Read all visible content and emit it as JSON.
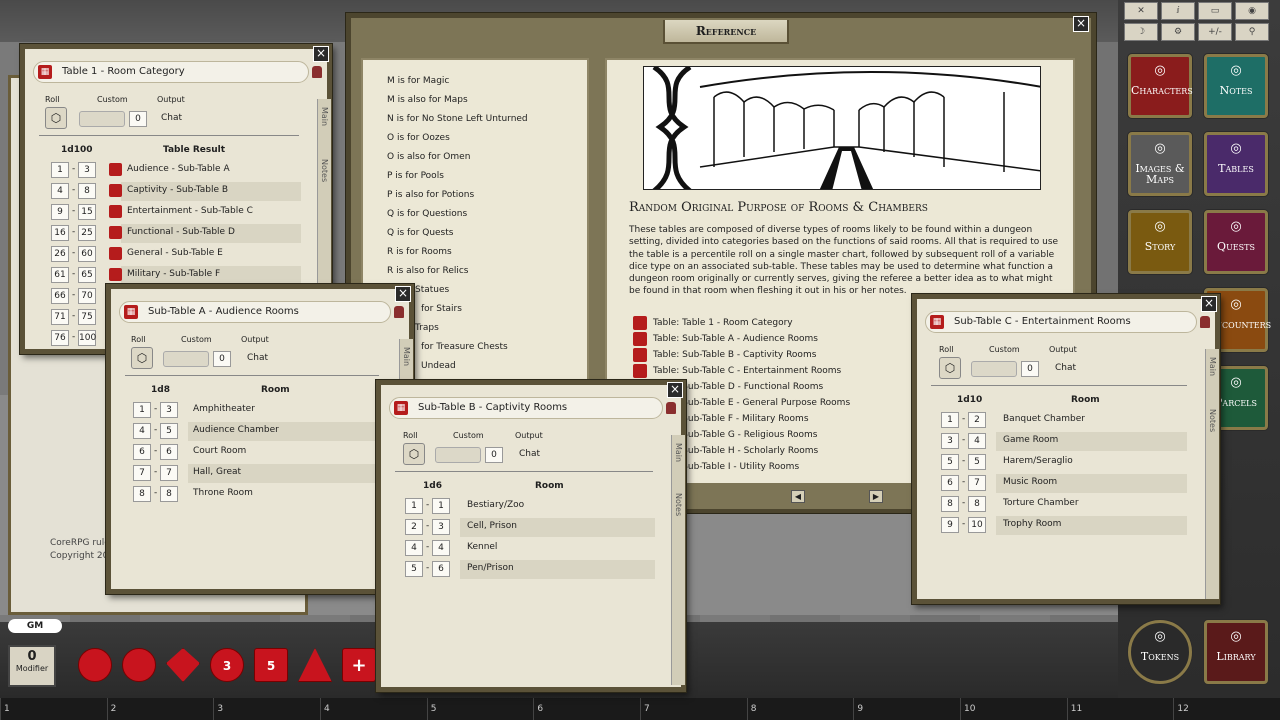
{
  "desktop": {
    "chat_text": "CoreRPG rule",
    "chat_copyright": "Copyright 20",
    "gm_label": "GM",
    "modifier_value": "0",
    "modifier_label": "Modifier",
    "dice": [
      "",
      "",
      "",
      "3",
      "5",
      "",
      ""
    ],
    "hotbar": [
      "1",
      "2",
      "3",
      "4",
      "5",
      "6",
      "7",
      "8",
      "9",
      "10",
      "11",
      "12"
    ]
  },
  "sidebar": {
    "tools": [
      "✕",
      "ⅈ",
      "▭",
      "◉",
      "☽",
      "⚙",
      "+/-",
      "⚲"
    ],
    "buttons": [
      "Characters",
      "Notes",
      "Images & Maps",
      "Tables",
      "Story",
      "Quests",
      "Encounters",
      "Parcels",
      "Tokens",
      "Library"
    ],
    "colors": {
      "Characters": "#8a1c1c",
      "Notes": "#1e6e66",
      "Images & Maps": "#5a5a5a",
      "Tables": "#4a2a6a",
      "Story": "#7a5a10",
      "Quests": "#6a1a3a",
      "Encounters": "#8a4a10",
      "Parcels": "#1e5a3a",
      "Tokens": "#2a2a2a",
      "Library": "#5a1a1a"
    }
  },
  "reference": {
    "title": "Reference",
    "index_items": [
      "M is for Magic",
      "M is also for Maps",
      "N is for No Stone Left Unturned",
      "O is for Oozes",
      "O is also for Omen",
      "P is for Pools",
      "P is also for Potions",
      "Q is for Questions",
      "Q is for Quests",
      "R is for Rooms",
      "R is also for Relics",
      "Statues",
      "for Stairs",
      "Traps",
      "for Treasure Chests",
      "Undead"
    ],
    "heading": "Random Original Purpose of Rooms & Chambers",
    "body": "These tables are composed of diverse types of rooms likely to be found within a dungeon setting, divided into categories based on the functions of said rooms. All that is required to use the table is a percentile roll on a single master chart, followed by subsequent roll of a variable dice type on an associated sub-table. These tables may be used to determine what function a dungeon room originally or currently serves, giving the referee a better idea as to what might be found in that room when fleshing it out in his or her notes.",
    "links": [
      "Table: Table 1 - Room Category",
      "Table: Sub-Table A - Audience Rooms",
      "Table: Sub-Table B - Captivity Rooms",
      "Table: Sub-Table C - Entertainment Rooms",
      "Table: Sub-Table D - Functional Rooms",
      "Table: Sub-Table E - General Purpose Rooms",
      "Table: Sub-Table F - Military Rooms",
      "Table: Sub-Table G - Religious Rooms",
      "Table: Sub-Table H - Scholarly Rooms",
      "Table: Sub-Table I - Utility Rooms"
    ]
  },
  "labels": {
    "roll": "Roll",
    "custom": "Custom",
    "output": "Output",
    "chat": "Chat",
    "zero": "0",
    "main": "Main",
    "notes": "Notes",
    "room": "Room",
    "table_result": "Table Result"
  },
  "table1": {
    "title": "Table 1 - Room Category",
    "dice": "1d100",
    "rows": [
      {
        "a": "1",
        "b": "3",
        "t": "Audience - Sub-Table A"
      },
      {
        "a": "4",
        "b": "8",
        "t": "Captivity - Sub-Table B"
      },
      {
        "a": "9",
        "b": "15",
        "t": "Entertainment - Sub-Table C"
      },
      {
        "a": "16",
        "b": "25",
        "t": "Functional - Sub-Table D"
      },
      {
        "a": "26",
        "b": "60",
        "t": "General - Sub-Table E"
      },
      {
        "a": "61",
        "b": "65",
        "t": "Military - Sub-Table F"
      },
      {
        "a": "66",
        "b": "70",
        "t": ""
      },
      {
        "a": "71",
        "b": "75",
        "t": ""
      },
      {
        "a": "76",
        "b": "100",
        "t": ""
      }
    ]
  },
  "tableA": {
    "title": "Sub-Table A - Audience Rooms",
    "dice": "1d8",
    "rows": [
      {
        "a": "1",
        "b": "3",
        "t": "Amphitheater"
      },
      {
        "a": "4",
        "b": "5",
        "t": "Audience Chamber"
      },
      {
        "a": "6",
        "b": "6",
        "t": "Court Room"
      },
      {
        "a": "7",
        "b": "7",
        "t": "Hall, Great"
      },
      {
        "a": "8",
        "b": "8",
        "t": "Throne Room"
      }
    ]
  },
  "tableB": {
    "title": "Sub-Table B - Captivity Rooms",
    "dice": "1d6",
    "rows": [
      {
        "a": "1",
        "b": "1",
        "t": "Bestiary/Zoo"
      },
      {
        "a": "2",
        "b": "3",
        "t": "Cell, Prison"
      },
      {
        "a": "4",
        "b": "4",
        "t": "Kennel"
      },
      {
        "a": "5",
        "b": "6",
        "t": "Pen/Prison"
      }
    ]
  },
  "tableC": {
    "title": "Sub-Table C - Entertainment Rooms",
    "dice": "1d10",
    "rows": [
      {
        "a": "1",
        "b": "2",
        "t": "Banquet Chamber"
      },
      {
        "a": "3",
        "b": "4",
        "t": "Game Room"
      },
      {
        "a": "5",
        "b": "5",
        "t": "Harem/Seraglio"
      },
      {
        "a": "6",
        "b": "7",
        "t": "Music Room"
      },
      {
        "a": "8",
        "b": "8",
        "t": "Torture Chamber"
      },
      {
        "a": "9",
        "b": "10",
        "t": "Trophy Room"
      }
    ]
  }
}
